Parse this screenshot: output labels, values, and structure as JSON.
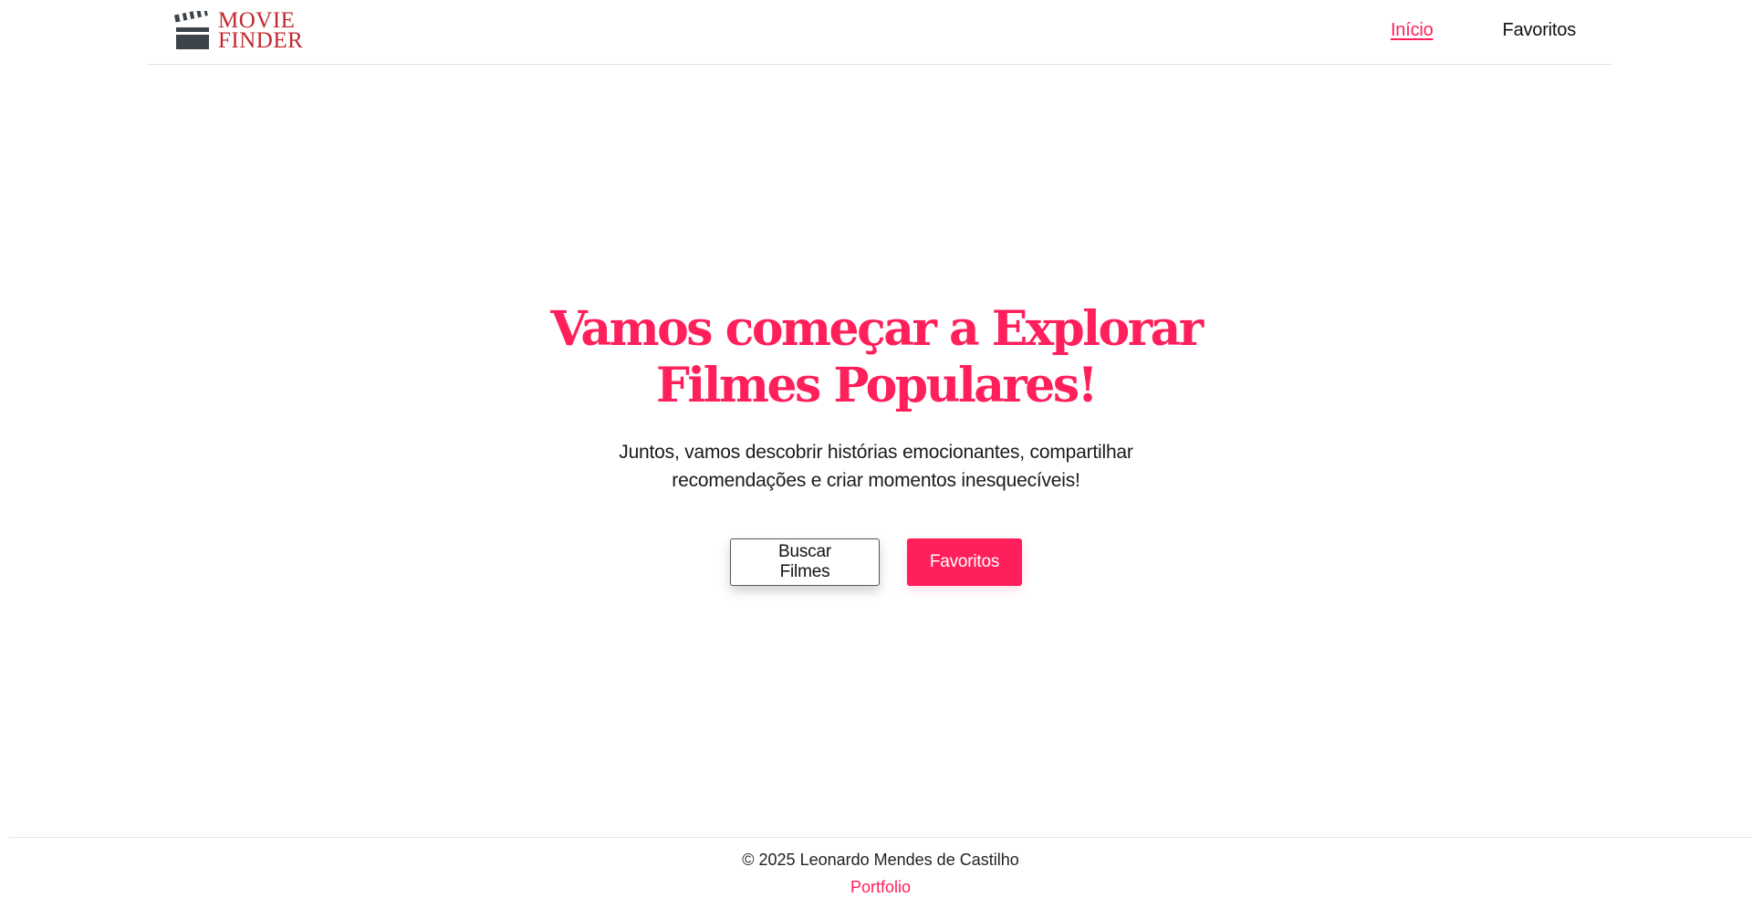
{
  "header": {
    "logo": {
      "line1": "MOVIE",
      "line2": "FINDER",
      "icon": "clapperboard-icon",
      "text_color": "#c0282e",
      "icon_color": "#3d4449"
    },
    "nav": {
      "home_label": "Início",
      "favorites_label": "Favoritos",
      "active_color": "#ff1f5a"
    }
  },
  "hero": {
    "title": "Vamos começar a Explorar Filmes Populares!",
    "subtitle": "Juntos, vamos descobrir histórias emocionantes, compartilhar recomendações e criar momentos inesquecíveis!",
    "buttons": {
      "search_label": "Buscar Filmes",
      "favorites_label": "Favoritos"
    },
    "accent_color": "#ff1f5a"
  },
  "footer": {
    "copyright": "© 2025 Leonardo Mendes de Castilho",
    "portfolio_label": "Portfolio"
  }
}
